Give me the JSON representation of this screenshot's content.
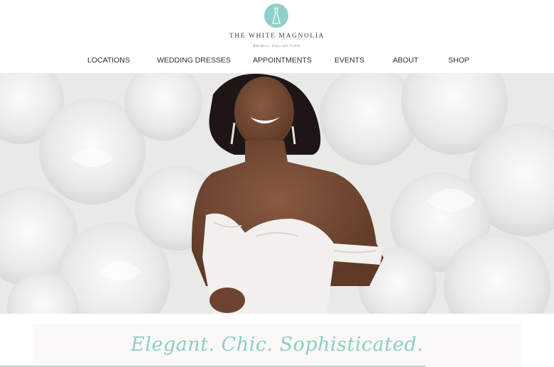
{
  "brand": {
    "name": "THE WHITE MAGNOLIA",
    "subtitle": "BRIDAL COLLECTION",
    "accent_color": "#8fd0cb",
    "logo_icon": "dress-icon"
  },
  "nav": {
    "items": [
      {
        "label": "LOCATIONS"
      },
      {
        "label": "WEDDING DRESSES"
      },
      {
        "label": "APPOINTMENTS"
      },
      {
        "label": "EVENTS"
      },
      {
        "label": "ABOUT"
      },
      {
        "label": "SHOP"
      }
    ]
  },
  "tagline": {
    "text": "Elegant. Chic. Sophisticated.",
    "color": "#8bcfc6"
  }
}
